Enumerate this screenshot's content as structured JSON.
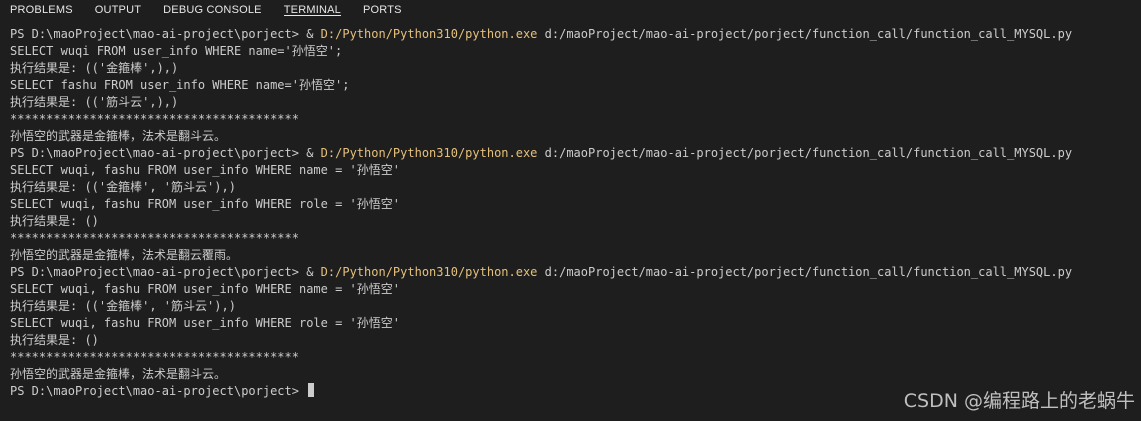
{
  "tabs": [
    {
      "label": "PROBLEMS"
    },
    {
      "label": "OUTPUT"
    },
    {
      "label": "DEBUG CONSOLE"
    },
    {
      "label": "TERMINAL",
      "active": true
    },
    {
      "label": "PORTS"
    }
  ],
  "terminal": {
    "prompt": "PS D:\\maoProject\\mao-ai-project\\porject> ",
    "exe_prefix": "& ",
    "exe_path": "D:/Python/Python310/python.exe",
    "script_path": " d:/maoProject/mao-ai-project/porject/function_call/function_call_MYSQL.py",
    "lines": [
      "SELECT wuqi FROM user_info WHERE name='孙悟空';",
      "执行结果是: (('金箍棒',),)",
      "SELECT fashu FROM user_info WHERE name='孙悟空';",
      "执行结果是: (('筋斗云',),)",
      "****************************************",
      "孙悟空的武器是金箍棒，法术是翻斗云。",
      "SELECT wuqi, fashu FROM user_info WHERE name = '孙悟空'",
      "执行结果是: (('金箍棒', '筋斗云'),)",
      "SELECT wuqi, fashu FROM user_info WHERE role = '孙悟空'",
      "执行结果是: ()",
      "****************************************",
      "孙悟空的武器是金箍棒，法术是翻云覆雨。",
      "SELECT wuqi, fashu FROM user_info WHERE name = '孙悟空'",
      "执行结果是: (('金箍棒', '筋斗云'),)",
      "SELECT wuqi, fashu FROM user_info WHERE role = '孙悟空'",
      "执行结果是: ()",
      "****************************************",
      "孙悟空的武器是金箍棒，法术是翻斗云。"
    ]
  },
  "watermark": "CSDN @编程路上的老蜗牛",
  "colors": {
    "background": "#1e1e1e",
    "text": "#cccccc",
    "exe_path": "#e5c07b"
  }
}
